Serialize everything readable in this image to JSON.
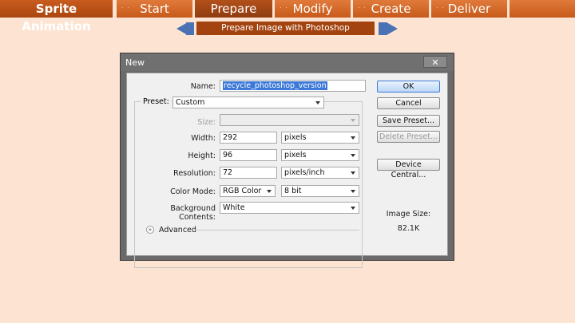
{
  "nav": {
    "brand": "Sprite Animation",
    "tabs": [
      "Start",
      "Prepare",
      "Modify",
      "Create",
      "Deliver"
    ],
    "active_tab": "Prepare"
  },
  "subheader": {
    "title": "Prepare Image with Photoshop"
  },
  "dialog": {
    "title": "New",
    "close_label": "✕",
    "fields": {
      "name_label": "Name:",
      "name_value": "recycle_photoshop_version",
      "preset_label": "Preset:",
      "preset_value": "Custom",
      "size_label": "Size:",
      "size_value": "",
      "width_label": "Width:",
      "width_value": "292",
      "width_unit": "pixels",
      "height_label": "Height:",
      "height_value": "96",
      "height_unit": "pixels",
      "resolution_label": "Resolution:",
      "resolution_value": "72",
      "resolution_unit": "pixels/inch",
      "color_mode_label": "Color Mode:",
      "color_mode_value": "RGB Color",
      "bit_depth_value": "8 bit",
      "background_label": "Background Contents:",
      "background_value": "White",
      "advanced_label": "Advanced"
    },
    "buttons": {
      "ok": "OK",
      "cancel": "Cancel",
      "save_preset": "Save Preset...",
      "delete_preset": "Delete Preset...",
      "device_central": "Device Central..."
    },
    "image_size_label": "Image Size:",
    "image_size_value": "82.1K"
  }
}
